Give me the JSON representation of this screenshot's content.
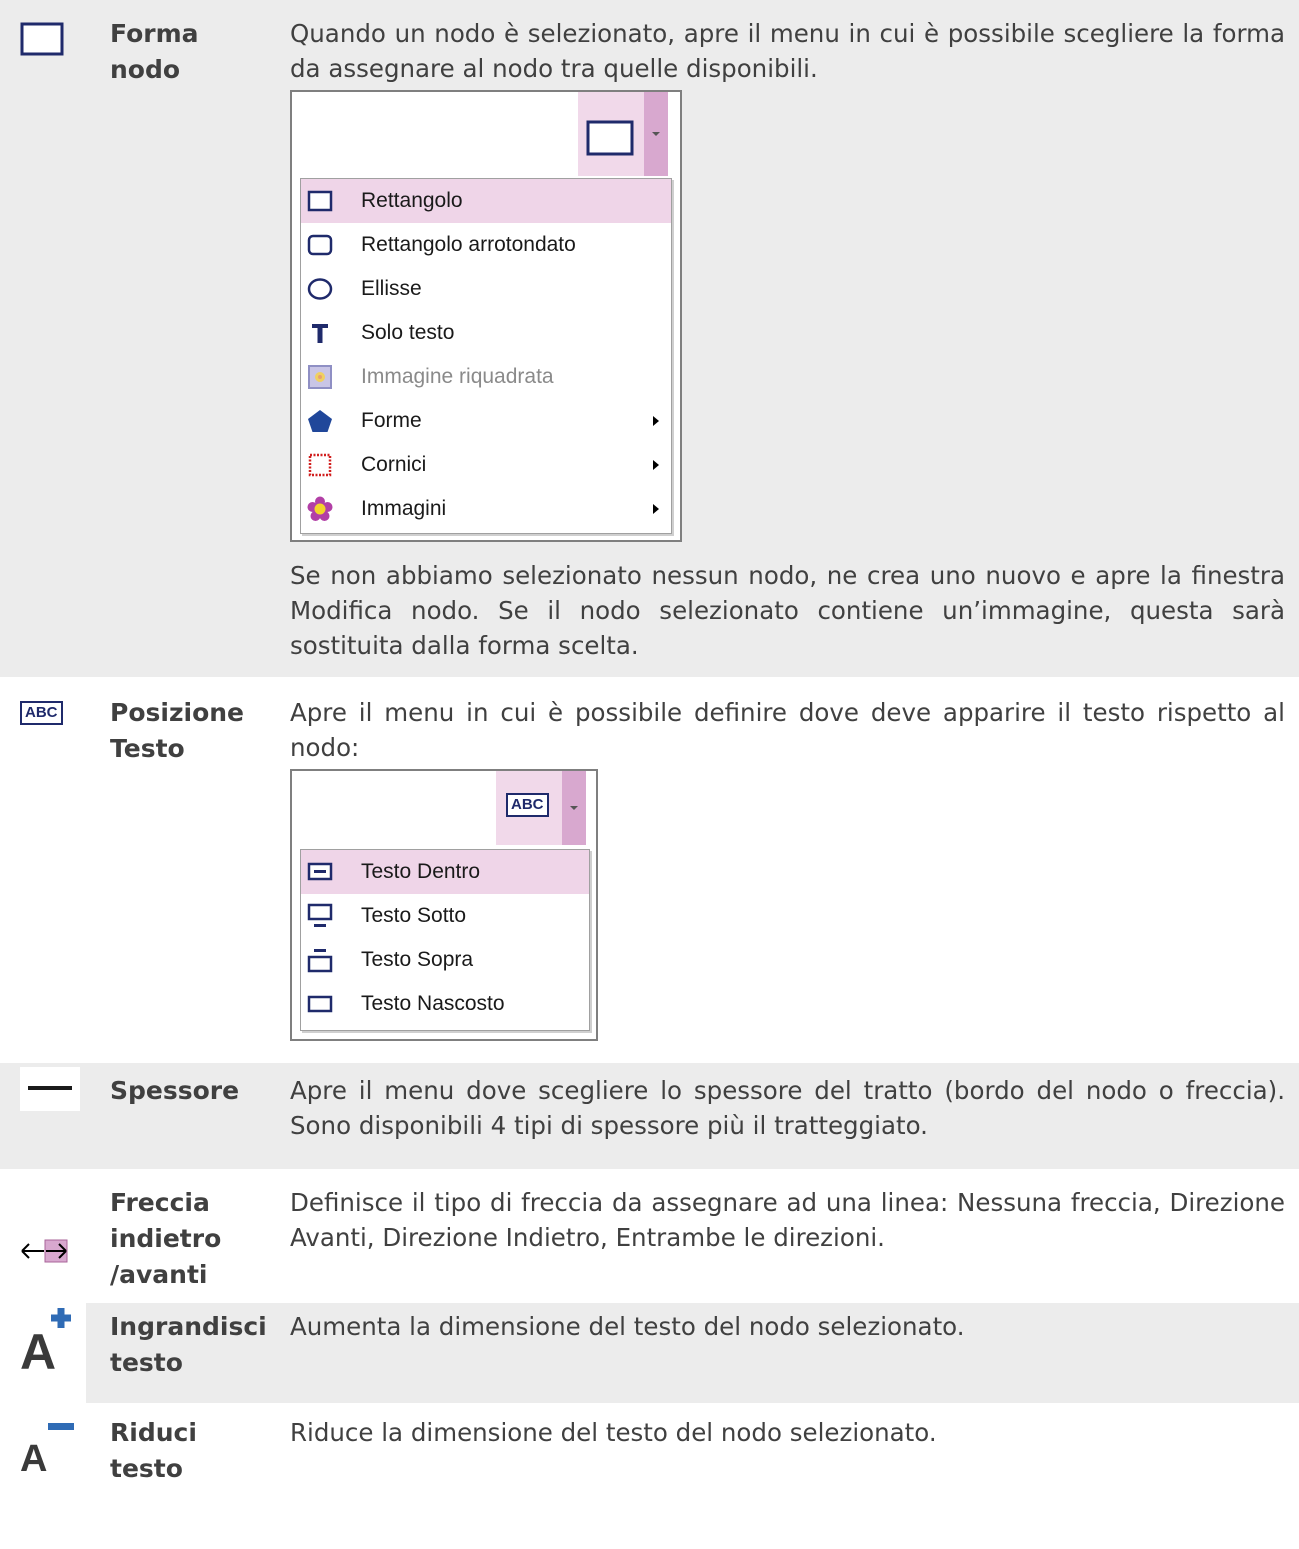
{
  "rows": [
    {
      "id": "forma-nodo",
      "label_lines": [
        "Forma",
        "nodo"
      ],
      "desc_before": "Quando un nodo è selezionato, apre il menu in cui è possibile scegliere la forma da assegnare al nodo tra quelle disponibili.",
      "menu": {
        "button_icon": "rectangle-icon",
        "items": [
          {
            "label": "Rettangolo",
            "icon": "rectangle-icon",
            "selected": true,
            "submenu": false,
            "disabled": false
          },
          {
            "label": "Rettangolo arrotondato",
            "icon": "rounded-rectangle-icon",
            "selected": false,
            "submenu": false,
            "disabled": false
          },
          {
            "label": "Ellisse",
            "icon": "ellipse-icon",
            "selected": false,
            "submenu": false,
            "disabled": false
          },
          {
            "label": "Solo testo",
            "icon": "text-t-icon",
            "selected": false,
            "submenu": false,
            "disabled": false
          },
          {
            "label": "Immagine riquadrata",
            "icon": "framed-image-icon",
            "selected": false,
            "submenu": false,
            "disabled": true
          },
          {
            "label": "Forme",
            "icon": "pentagon-icon",
            "selected": false,
            "submenu": true,
            "disabled": false
          },
          {
            "label": "Cornici",
            "icon": "dotted-frame-icon",
            "selected": false,
            "submenu": true,
            "disabled": false
          },
          {
            "label": "Immagini",
            "icon": "flower-icon",
            "selected": false,
            "submenu": true,
            "disabled": false
          }
        ]
      },
      "desc_after": "Se non abbiamo selezionato nessun nodo, ne crea uno nuovo e apre la finestra Modifica nodo. Se il nodo selezionato contiene un’immagine, questa sarà sostituita dalla forma scelta."
    },
    {
      "id": "posizione-testo",
      "label_lines": [
        "Posizione",
        "Testo"
      ],
      "icon_text": "ABC",
      "desc_before": "Apre il menu in cui è possibile definire dove deve apparire il testo rispetto al nodo:",
      "menu": {
        "button_text": "ABC",
        "items": [
          {
            "label": "Testo Dentro",
            "icon": "text-inside-icon",
            "selected": true
          },
          {
            "label": "Testo Sotto",
            "icon": "text-below-icon",
            "selected": false
          },
          {
            "label": "Testo Sopra",
            "icon": "text-above-icon",
            "selected": false
          },
          {
            "label": "Testo Nascosto",
            "icon": "text-hidden-icon",
            "selected": false
          }
        ]
      }
    },
    {
      "id": "spessore",
      "label_lines": [
        "Spessore"
      ],
      "desc": "Apre il menu dove scegliere lo spessore del tratto (bordo del nodo o freccia). Sono disponibili 4 tipi di spessore più il tratteggiato."
    },
    {
      "id": "freccia",
      "label_lines": [
        "Freccia",
        "indietro",
        "/avanti"
      ],
      "desc": "Definisce il tipo di freccia da assegnare ad una linea: Nessuna freccia, Direzione Avanti, Direzione Indietro, Entrambe le direzioni."
    },
    {
      "id": "ingrandisci",
      "label_lines": [
        "Ingrandisci",
        "testo"
      ],
      "icon_text": "A",
      "desc": "Aumenta la dimensione del testo del nodo selezionato."
    },
    {
      "id": "riduci",
      "label_lines": [
        "Riduci",
        "testo"
      ],
      "icon_text": "A",
      "desc": "Riduce la dimensione del testo del nodo selezionato."
    }
  ],
  "colors": {
    "shade": "#ececec",
    "navy": "#1f2a6b",
    "selection": "#efd5e8",
    "button_face": "#f1d9ea",
    "arrow_face": "#d8a8cf",
    "plus_blue": "#2f6bb5"
  }
}
